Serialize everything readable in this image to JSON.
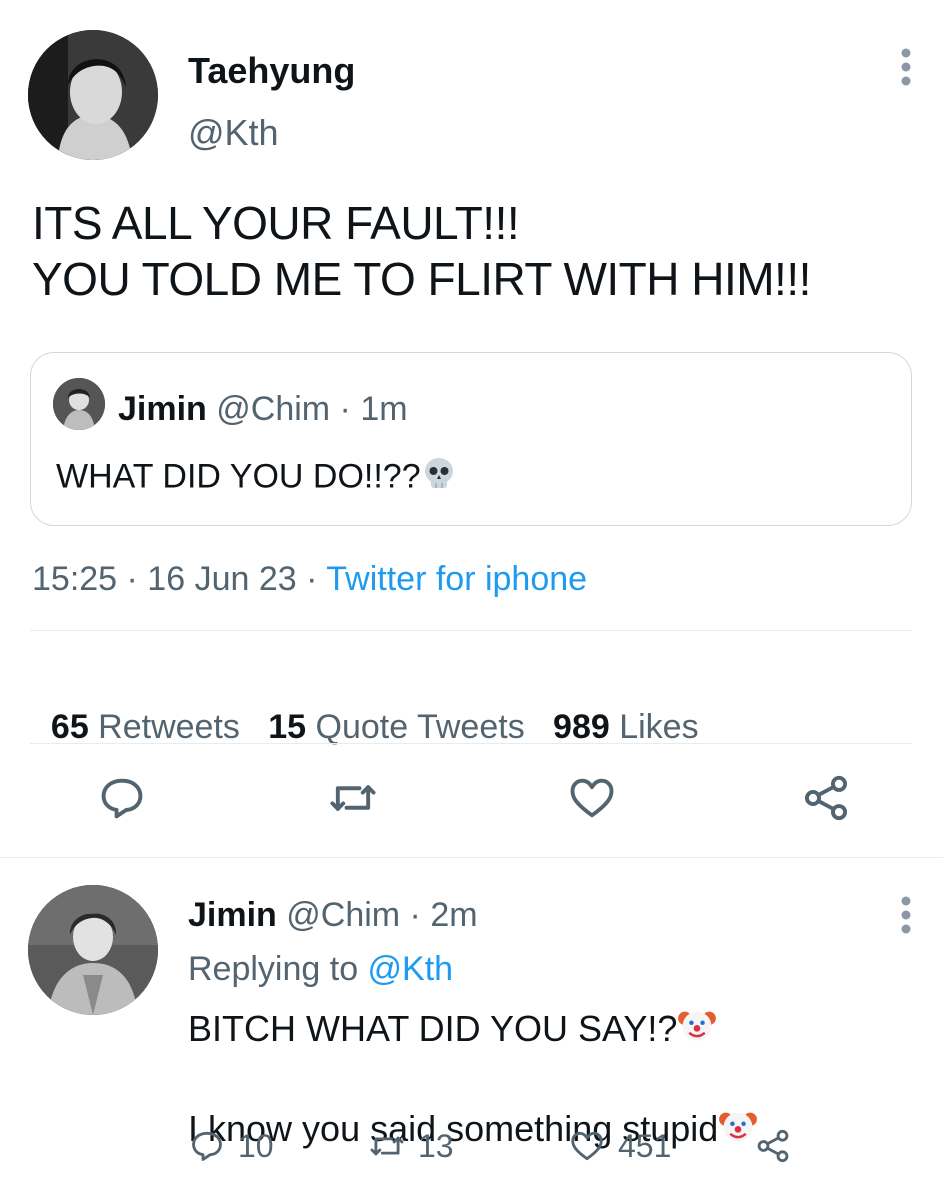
{
  "main_tweet": {
    "name": "Taehyung",
    "handle": "@Kth",
    "text": "ITS ALL YOUR FAULT!!!\nYOU TOLD ME TO FLIRT WITH HIM!!!",
    "quote": {
      "name": "Jimin",
      "handle_time": " @Chim · 1m",
      "text": "WHAT DID YOU DO!!??",
      "emoji": "skull-emoji"
    },
    "time": "15:25",
    "date": " · 16 Jun 23 · ",
    "source": "Twitter for iphone",
    "stats": {
      "retweets_count": "65",
      "retweets_label": " Retweets   ",
      "quotes_count": "15",
      "quotes_label": " Quote Tweets   ",
      "likes_count": "989",
      "likes_label": " Likes"
    }
  },
  "reply_tweet": {
    "name": "Jimin",
    "handle_time": " @Chim · 2m",
    "replying_prefix": "Replying to ",
    "replying_to": "@Kth",
    "line1": "BITCH WHAT DID YOU SAY!?",
    "line2": "I know you said something stupid",
    "emoji": "clown-emoji",
    "reply_count": "10",
    "retweet_count": "13",
    "like_count": "451"
  },
  "colors": {
    "text": "#0f1419",
    "secondary": "#536471",
    "accent": "#1d9bf0",
    "border": "#cfd9de"
  },
  "icons": [
    "more-vertical-icon",
    "reply-icon",
    "retweet-icon",
    "like-icon",
    "share-icon"
  ]
}
